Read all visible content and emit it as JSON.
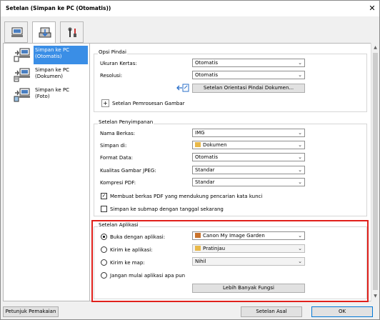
{
  "window": {
    "title": "Setelan (Simpan ke PC (Otomatis))",
    "close": "✕"
  },
  "top_tabs": [
    {
      "name": "scan-from-computer",
      "icon": "computer-scan-icon"
    },
    {
      "name": "scan-from-operation-panel",
      "icon": "scanner-icon"
    },
    {
      "name": "general-settings",
      "icon": "tools-icon"
    }
  ],
  "sidebar": {
    "items": [
      {
        "line1": "Simpan ke PC",
        "line2": "(Otomatis)"
      },
      {
        "line1": "Simpan ke PC",
        "line2": "(Dokumen)"
      },
      {
        "line1": "Simpan ke PC",
        "line2": "(Foto)"
      }
    ]
  },
  "scan_options": {
    "title": "Opsi Pindai",
    "paper_size_label": "Ukuran Kertas:",
    "paper_size_value": "Otomatis",
    "resolution_label": "Resolusi:",
    "resolution_value": "Otomatis",
    "orientation_button": "Setelan Orientasi Pindai Dokumen...",
    "image_processing": "Setelan Pemrosesan Gambar",
    "plus": "+"
  },
  "save_settings": {
    "title": "Setelan Penyimpanan",
    "file_name_label": "Nama Berkas:",
    "file_name_value": "IMG",
    "save_in_label": "Simpan di:",
    "save_in_value": "Dokumen",
    "data_format_label": "Format Data:",
    "data_format_value": "Otomatis",
    "jpeg_quality_label": "Kualitas Gambar JPEG:",
    "jpeg_quality_value": "Standar",
    "pdf_compression_label": "Kompresi PDF:",
    "pdf_compression_value": "Standar",
    "keyword_search_label": "Membuat berkas PDF yang mendukung pencarian kata kunci",
    "subfolder_label": "Simpan ke submap dengan tanggal sekarang"
  },
  "app_settings": {
    "title": "Setelan Aplikasi",
    "open_with_label": "Buka dengan aplikasi:",
    "open_with_value": "Canon My Image Garden",
    "send_to_app_label": "Kirim ke aplikasi:",
    "send_to_app_value": "Pratinjau",
    "send_to_folder_label": "Kirim ke map:",
    "send_to_folder_value": "Nihil",
    "do_not_start_label": "Jangan mulai aplikasi apa pun",
    "more_functions_button": "Lebih Banyak Fungsi",
    "selected_option": "open_with"
  },
  "footer": {
    "instructions_button": "Petunjuk Pemakaian",
    "defaults_button": "Setelan Asal",
    "ok_button": "OK"
  },
  "colors": {
    "accent": "#3a8ee6",
    "highlight": "#e0201b"
  }
}
